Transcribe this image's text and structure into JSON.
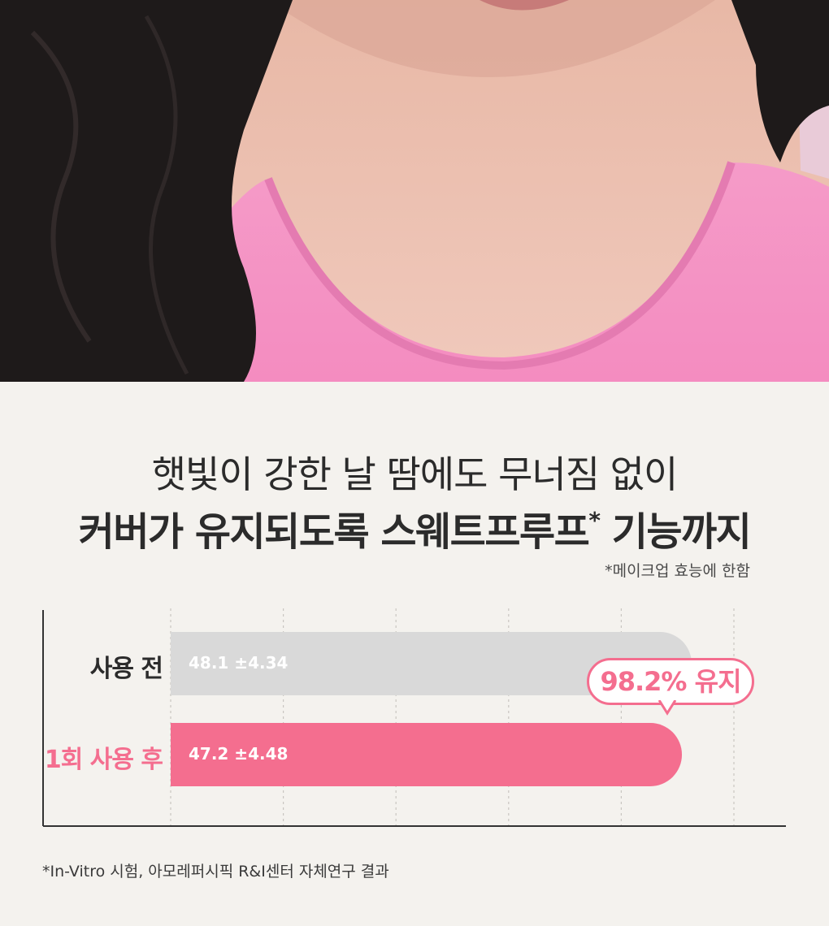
{
  "headline": {
    "line1": "햇빛이 강한 날 땀에도 무너짐 없이",
    "line2": "커버가 유지되도록 스웨트프루프",
    "line2_mark": "*",
    "line2_end": " 기능까지"
  },
  "footnote_top": "*메이크업 효능에 한함",
  "chart_data": {
    "type": "bar",
    "orientation": "horizontal",
    "categories": [
      "사용 전",
      "1회 사용 후"
    ],
    "values": [
      48.1,
      47.2
    ],
    "value_labels": [
      "48.1 ±4.34",
      "47.2 ±4.48"
    ],
    "colors": [
      "#d9d9d9",
      "#f46e8f"
    ],
    "label_colors": [
      "#2b2b2b",
      "#f46e8f"
    ],
    "xlim": [
      0,
      52
    ],
    "grid": true,
    "annotation": "98.2% 유지",
    "annotation_color": "#f46e8f"
  },
  "footnote_bottom": "*In-Vitro 시험, 아모레퍼시픽 R&I센터 자체연구 결과"
}
